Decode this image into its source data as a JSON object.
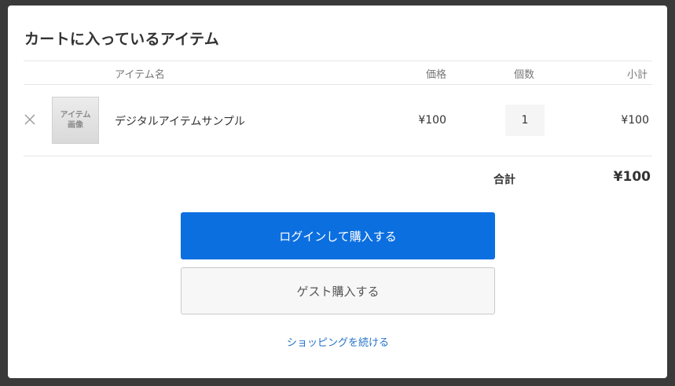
{
  "modal": {
    "title": "カートに入っているアイテム"
  },
  "table": {
    "headers": {
      "item_name": "アイテム名",
      "price": "価格",
      "quantity": "個数",
      "subtotal": "小計"
    },
    "rows": [
      {
        "thumbnail_text": "アイテム\n画像",
        "name": "デジタルアイテムサンプル",
        "price": "¥100",
        "quantity": "1",
        "subtotal": "¥100"
      }
    ]
  },
  "summary": {
    "total_label": "合計",
    "total_value": "¥100"
  },
  "actions": {
    "login_purchase": "ログインして購入する",
    "guest_purchase": "ゲスト購入する",
    "continue_shopping": "ショッピングを続ける"
  },
  "colors": {
    "primary": "#0c6fe0",
    "link": "#2673c8",
    "overlay": "#3a3a3a"
  },
  "icons": {
    "remove": "close-icon"
  }
}
